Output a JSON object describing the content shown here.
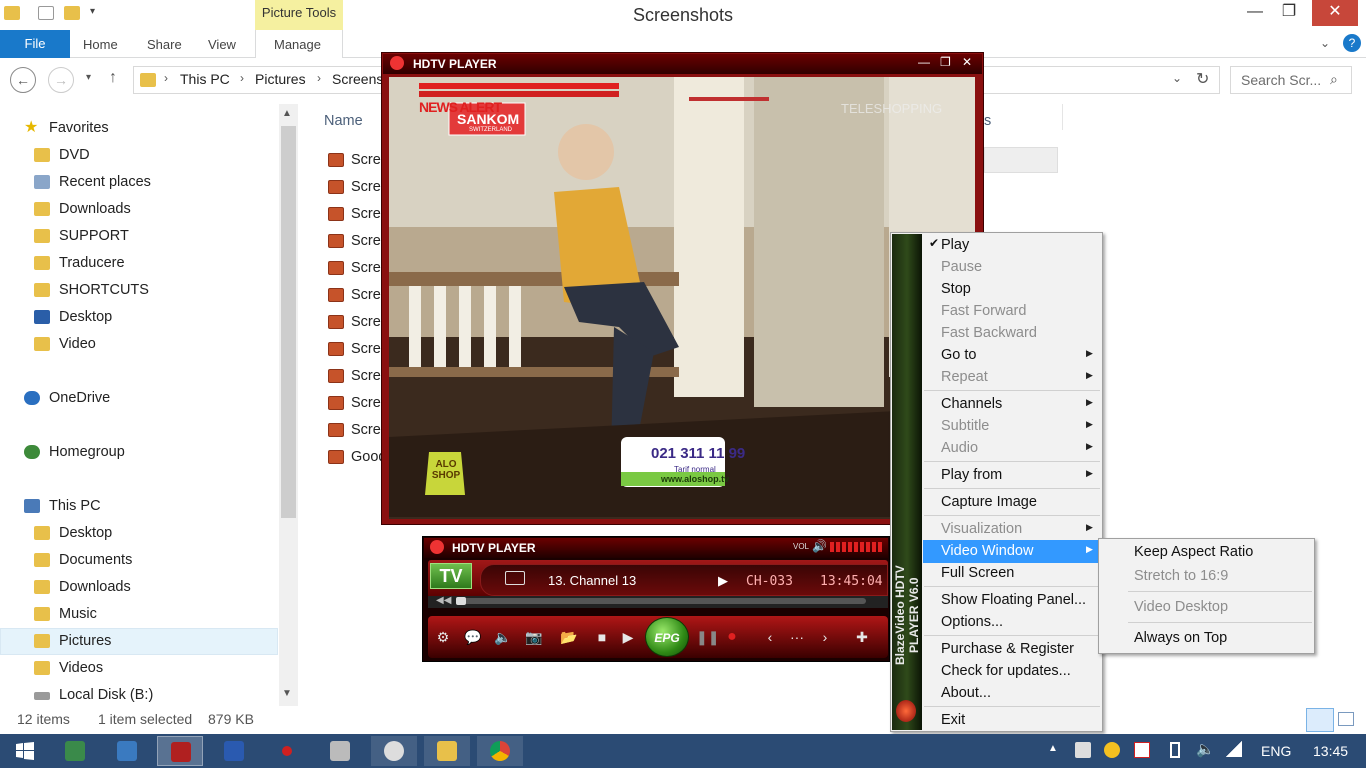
{
  "window": {
    "title": "Screenshots",
    "context_tab": "Picture Tools",
    "min_glyph": "—",
    "max_glyph": "❐",
    "close_glyph": "✕"
  },
  "ribbon": {
    "tabs": [
      "File",
      "Home",
      "Share",
      "View",
      "Manage"
    ]
  },
  "addressbar": {
    "path": [
      "This PC",
      "Pictures",
      "Screens"
    ],
    "search_placeholder": "Search Scr..."
  },
  "navpane": {
    "favorites": {
      "label": "Favorites",
      "items": [
        "DVD",
        "Recent places",
        "Downloads",
        "SUPPORT",
        "Traducere",
        "SHORTCUTS",
        "Desktop",
        "Video"
      ]
    },
    "onedrive": "OneDrive",
    "homegroup": "Homegroup",
    "thispc": {
      "label": "This PC",
      "items": [
        "Desktop",
        "Documents",
        "Downloads",
        "Music",
        "Pictures",
        "Videos",
        "Local Disk (B:)"
      ]
    },
    "selected": "Pictures"
  },
  "filelist": {
    "header_name": "Name",
    "header_partial": "s",
    "rows": [
      "Scree",
      "Scree",
      "Scree",
      "Scree",
      "Scree",
      "Scree",
      "Scree",
      "Scree",
      "Scree",
      "Scree",
      "Scree",
      "Good"
    ]
  },
  "statusbar": {
    "items_count": "12 items",
    "selection": "1 item selected",
    "size": "879 KB"
  },
  "hdtv_video": {
    "title": "HDTV PLAYER",
    "overlay_news": "NEWS ALERT",
    "overlay_logo": "SANKOM",
    "overlay_logo_sub": "SWITZERLAND",
    "overlay_teleshop": "TELESHOPPING",
    "phone": "021 311 11 99",
    "phone_sub": "Tarif normal",
    "website": "www.aloshop.tv",
    "shop_bag": "ALO SHOP"
  },
  "hdtv_panel": {
    "title": "HDTV PLAYER",
    "tv_button": "TV",
    "vol_label": "VOL",
    "channel": "13. Channel 13",
    "channel_code": "CH-033",
    "time": "13:45:04",
    "epg_label": "EPG"
  },
  "context_menu": {
    "brand": "BlazeVideo HDTV PLAYER V6.0",
    "items": [
      {
        "label": "Play",
        "checked": true
      },
      {
        "label": "Pause",
        "disabled": true
      },
      {
        "label": "Stop"
      },
      {
        "label": "Fast Forward",
        "disabled": true
      },
      {
        "label": "Fast Backward",
        "disabled": true
      },
      {
        "label": "Go to",
        "submenu": true
      },
      {
        "label": "Repeat",
        "disabled": true,
        "submenu": true
      },
      {
        "label": "Channels",
        "submenu": true
      },
      {
        "label": "Subtitle",
        "disabled": true,
        "submenu": true
      },
      {
        "label": "Audio",
        "disabled": true,
        "submenu": true
      },
      {
        "label": "Play from",
        "submenu": true
      },
      {
        "label": "Capture Image"
      },
      {
        "label": "Visualization",
        "disabled": true,
        "submenu": true
      },
      {
        "label": "Video Window",
        "submenu": true,
        "highlighted": true
      },
      {
        "label": "Full Screen"
      },
      {
        "label": "Show Floating Panel..."
      },
      {
        "label": "Options..."
      },
      {
        "label": "Purchase & Register"
      },
      {
        "label": "Check for updates..."
      },
      {
        "label": "About..."
      },
      {
        "label": "Exit"
      }
    ],
    "check_glyph": "✔",
    "arrow_glyph": "▶"
  },
  "submenu": {
    "items": [
      {
        "label": "Keep Aspect Ratio"
      },
      {
        "label": "Stretch to 16:9",
        "disabled": true
      },
      {
        "label": "Video Desktop",
        "disabled": true
      },
      {
        "label": "Always on Top"
      }
    ]
  },
  "taskbar": {
    "language": "ENG",
    "clock": "13:45"
  },
  "colors": {
    "accent": "#1979ca",
    "highlight": "#3399ff",
    "taskbar": "#2b4b74",
    "player_red": "#8a1010"
  }
}
